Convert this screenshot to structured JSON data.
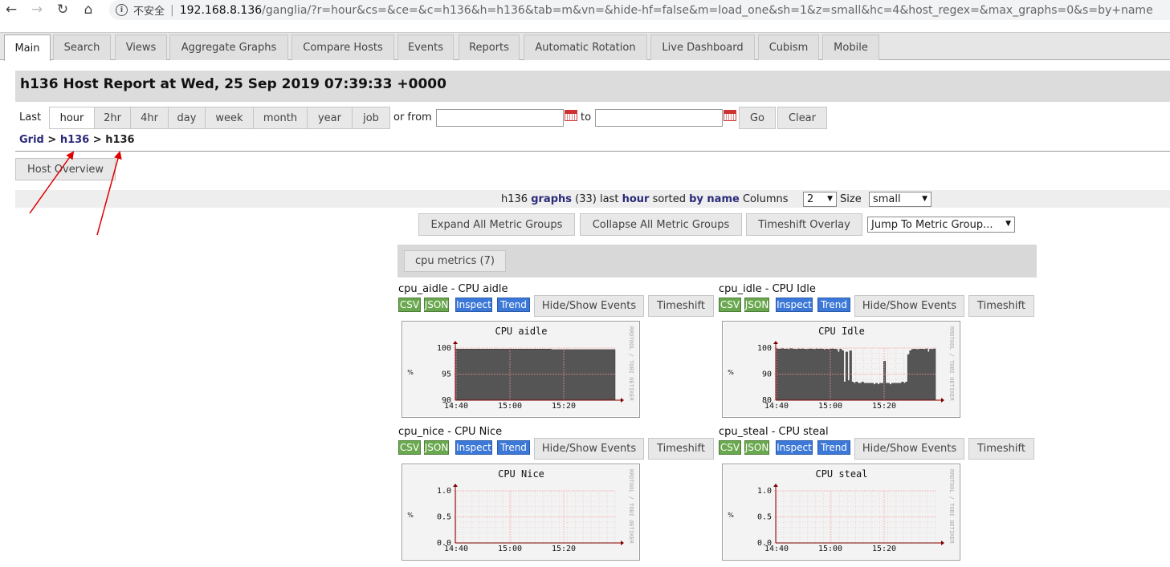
{
  "browser": {
    "insecure_label": "不安全",
    "url_host": "192.168.8.136",
    "url_path": "/ganglia/?r=hour&cs=&ce=&c=h136&h=h136&tab=m&vn=&hide-hf=false&m=load_one&sh=1&z=small&hc=4&host_regex=&max_graphs=0&s=by+name"
  },
  "tabs": [
    "Main",
    "Search",
    "Views",
    "Aggregate Graphs",
    "Compare Hosts",
    "Events",
    "Reports",
    "Automatic Rotation",
    "Live Dashboard",
    "Cubism",
    "Mobile"
  ],
  "header": {
    "title": "h136 Host Report at Wed, 25 Sep 2019 07:39:33 +0000"
  },
  "range": {
    "last_label": "Last",
    "options": [
      "hour",
      "2hr",
      "4hr",
      "day",
      "week",
      "month",
      "year",
      "job"
    ],
    "selected": "hour",
    "or_from_label": "or from",
    "to_label": "to",
    "from_value": "",
    "to_value": "",
    "go_label": "Go",
    "clear_label": "Clear"
  },
  "breadcrumb": {
    "grid": "Grid",
    "sep": ">",
    "cluster": "h136",
    "host": "h136"
  },
  "host_overview_label": "Host Overview",
  "graphs_bar": {
    "host": "h136",
    "graphs_word": "graphs",
    "count": "(33)",
    "last_word": "last",
    "range": "hour",
    "sorted_word": "sorted",
    "by_name": "by name",
    "columns_label": "Columns",
    "columns_value": "2",
    "size_label": "Size",
    "size_value": "small"
  },
  "controls": {
    "expand": "Expand All Metric Groups",
    "collapse": "Collapse All Metric Groups",
    "timeshift_overlay": "Timeshift Overlay",
    "jump": "Jump To Metric Group..."
  },
  "metric_group": {
    "label": "cpu metrics (7)"
  },
  "graph_buttons": {
    "csv": "CSV",
    "json": "JSON",
    "inspect": "Inspect",
    "trend": "Trend",
    "hide_show": "Hide/Show Events",
    "timeshift": "Timeshift"
  },
  "colors": {
    "area": "#555555",
    "grid": "#ff9999",
    "axis": "#800000",
    "link": "#2a2a7a",
    "annotation": "#e00000"
  },
  "graphs": [
    {
      "caption": "cpu_aidle - CPU aidle",
      "chart_title": "CPU aidle",
      "ylabel": "%",
      "yticks": [
        "100",
        "95",
        "90"
      ],
      "xticks": [
        "14:40",
        "15:00",
        "15:20"
      ],
      "watermark": "RRDTOOL / TOBI OETIKER"
    },
    {
      "caption": "cpu_idle - CPU Idle",
      "chart_title": "CPU Idle",
      "ylabel": "%",
      "yticks": [
        "100",
        "90",
        "80"
      ],
      "xticks": [
        "14:40",
        "15:00",
        "15:20"
      ],
      "watermark": "RRDTOOL / TOBI OETIKER"
    },
    {
      "caption": "cpu_nice - CPU Nice",
      "chart_title": "CPU Nice",
      "ylabel": "%",
      "yticks": [
        "1.0",
        "0.5",
        "0.0"
      ],
      "xticks": [
        "14:40",
        "15:00",
        "15:20"
      ],
      "watermark": "RRDTOOL / TOBI OETIKER"
    },
    {
      "caption": "cpu_steal - CPU steal",
      "chart_title": "CPU steal",
      "ylabel": "%",
      "yticks": [
        "1.0",
        "0.5",
        "0.0"
      ],
      "xticks": [
        "14:40",
        "15:00",
        "15:20"
      ],
      "watermark": "RRDTOOL / TOBI OETIKER"
    }
  ],
  "chart_data": [
    {
      "type": "area",
      "title": "CPU aidle",
      "ylabel": "%",
      "ylim": [
        90,
        100
      ],
      "x": [
        "14:40",
        "15:00",
        "15:20"
      ],
      "series": [
        {
          "values": [
            99.8,
            99.8,
            99.8,
            99.8,
            99.8,
            99.8,
            99.8,
            99.8,
            99.8,
            99.7,
            99.7,
            99.7,
            99.7,
            99.7,
            99.7
          ]
        }
      ]
    },
    {
      "type": "area",
      "title": "CPU Idle",
      "ylabel": "%",
      "ylim": [
        80,
        100
      ],
      "x": [
        "14:40",
        "15:00",
        "15:20"
      ],
      "series": [
        {
          "values": [
            99.8,
            99.6,
            99.7,
            99.8,
            99.6,
            99.7,
            99.5,
            99.8,
            99.7,
            99.6,
            99.5,
            99.7,
            99.6,
            99.7,
            99.6,
            99.5,
            99.6,
            99.7,
            99.6,
            99.5,
            99.7,
            99.6,
            99.7,
            99.6,
            99.4,
            99.6,
            99.5,
            99.6,
            99.7,
            99.6,
            99.5,
            98.5,
            99.6,
            99.0,
            87.0,
            98.5,
            87.5,
            99.0,
            87.0,
            86.5,
            87.0,
            86.5,
            86.5,
            87.0,
            86.5,
            86.5,
            86.5,
            86.5,
            86.5,
            86.0,
            86.5,
            86.0,
            86.5,
            86.5,
            95.0,
            86.5,
            86.5,
            86.0,
            86.5,
            86.5,
            86.5,
            86.5,
            86.5,
            87.0,
            86.5,
            87.0,
            97.5,
            99.0,
            99.5,
            99.6,
            99.5,
            99.5,
            99.6,
            99.6,
            99.5,
            99.7,
            98.5,
            99.6,
            99.5,
            99.7
          ]
        }
      ]
    },
    {
      "type": "line",
      "title": "CPU Nice",
      "ylabel": "%",
      "ylim": [
        0,
        1.0
      ],
      "x": [
        "14:40",
        "15:00",
        "15:20"
      ],
      "series": [
        {
          "values": [
            0,
            0,
            0,
            0,
            0,
            0,
            0,
            0,
            0,
            0
          ]
        }
      ]
    },
    {
      "type": "line",
      "title": "CPU steal",
      "ylabel": "%",
      "ylim": [
        0,
        1.0
      ],
      "x": [
        "14:40",
        "15:00",
        "15:20"
      ],
      "series": [
        {
          "values": [
            0,
            0,
            0,
            0,
            0,
            0,
            0,
            0,
            0,
            0
          ]
        }
      ]
    }
  ]
}
